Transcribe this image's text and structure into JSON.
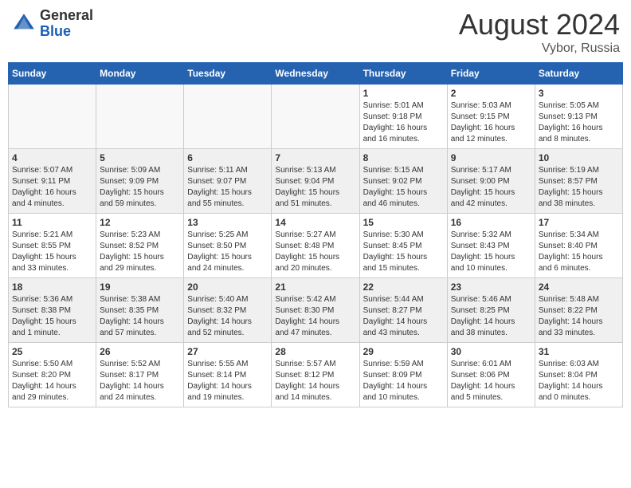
{
  "header": {
    "logo_general": "General",
    "logo_blue": "Blue",
    "month_year": "August 2024",
    "location": "Vybor, Russia"
  },
  "weekdays": [
    "Sunday",
    "Monday",
    "Tuesday",
    "Wednesday",
    "Thursday",
    "Friday",
    "Saturday"
  ],
  "weeks": [
    [
      {
        "day": "",
        "info": ""
      },
      {
        "day": "",
        "info": ""
      },
      {
        "day": "",
        "info": ""
      },
      {
        "day": "",
        "info": ""
      },
      {
        "day": "1",
        "info": "Sunrise: 5:01 AM\nSunset: 9:18 PM\nDaylight: 16 hours\nand 16 minutes."
      },
      {
        "day": "2",
        "info": "Sunrise: 5:03 AM\nSunset: 9:15 PM\nDaylight: 16 hours\nand 12 minutes."
      },
      {
        "day": "3",
        "info": "Sunrise: 5:05 AM\nSunset: 9:13 PM\nDaylight: 16 hours\nand 8 minutes."
      }
    ],
    [
      {
        "day": "4",
        "info": "Sunrise: 5:07 AM\nSunset: 9:11 PM\nDaylight: 16 hours\nand 4 minutes."
      },
      {
        "day": "5",
        "info": "Sunrise: 5:09 AM\nSunset: 9:09 PM\nDaylight: 15 hours\nand 59 minutes."
      },
      {
        "day": "6",
        "info": "Sunrise: 5:11 AM\nSunset: 9:07 PM\nDaylight: 15 hours\nand 55 minutes."
      },
      {
        "day": "7",
        "info": "Sunrise: 5:13 AM\nSunset: 9:04 PM\nDaylight: 15 hours\nand 51 minutes."
      },
      {
        "day": "8",
        "info": "Sunrise: 5:15 AM\nSunset: 9:02 PM\nDaylight: 15 hours\nand 46 minutes."
      },
      {
        "day": "9",
        "info": "Sunrise: 5:17 AM\nSunset: 9:00 PM\nDaylight: 15 hours\nand 42 minutes."
      },
      {
        "day": "10",
        "info": "Sunrise: 5:19 AM\nSunset: 8:57 PM\nDaylight: 15 hours\nand 38 minutes."
      }
    ],
    [
      {
        "day": "11",
        "info": "Sunrise: 5:21 AM\nSunset: 8:55 PM\nDaylight: 15 hours\nand 33 minutes."
      },
      {
        "day": "12",
        "info": "Sunrise: 5:23 AM\nSunset: 8:52 PM\nDaylight: 15 hours\nand 29 minutes."
      },
      {
        "day": "13",
        "info": "Sunrise: 5:25 AM\nSunset: 8:50 PM\nDaylight: 15 hours\nand 24 minutes."
      },
      {
        "day": "14",
        "info": "Sunrise: 5:27 AM\nSunset: 8:48 PM\nDaylight: 15 hours\nand 20 minutes."
      },
      {
        "day": "15",
        "info": "Sunrise: 5:30 AM\nSunset: 8:45 PM\nDaylight: 15 hours\nand 15 minutes."
      },
      {
        "day": "16",
        "info": "Sunrise: 5:32 AM\nSunset: 8:43 PM\nDaylight: 15 hours\nand 10 minutes."
      },
      {
        "day": "17",
        "info": "Sunrise: 5:34 AM\nSunset: 8:40 PM\nDaylight: 15 hours\nand 6 minutes."
      }
    ],
    [
      {
        "day": "18",
        "info": "Sunrise: 5:36 AM\nSunset: 8:38 PM\nDaylight: 15 hours\nand 1 minute."
      },
      {
        "day": "19",
        "info": "Sunrise: 5:38 AM\nSunset: 8:35 PM\nDaylight: 14 hours\nand 57 minutes."
      },
      {
        "day": "20",
        "info": "Sunrise: 5:40 AM\nSunset: 8:32 PM\nDaylight: 14 hours\nand 52 minutes."
      },
      {
        "day": "21",
        "info": "Sunrise: 5:42 AM\nSunset: 8:30 PM\nDaylight: 14 hours\nand 47 minutes."
      },
      {
        "day": "22",
        "info": "Sunrise: 5:44 AM\nSunset: 8:27 PM\nDaylight: 14 hours\nand 43 minutes."
      },
      {
        "day": "23",
        "info": "Sunrise: 5:46 AM\nSunset: 8:25 PM\nDaylight: 14 hours\nand 38 minutes."
      },
      {
        "day": "24",
        "info": "Sunrise: 5:48 AM\nSunset: 8:22 PM\nDaylight: 14 hours\nand 33 minutes."
      }
    ],
    [
      {
        "day": "25",
        "info": "Sunrise: 5:50 AM\nSunset: 8:20 PM\nDaylight: 14 hours\nand 29 minutes."
      },
      {
        "day": "26",
        "info": "Sunrise: 5:52 AM\nSunset: 8:17 PM\nDaylight: 14 hours\nand 24 minutes."
      },
      {
        "day": "27",
        "info": "Sunrise: 5:55 AM\nSunset: 8:14 PM\nDaylight: 14 hours\nand 19 minutes."
      },
      {
        "day": "28",
        "info": "Sunrise: 5:57 AM\nSunset: 8:12 PM\nDaylight: 14 hours\nand 14 minutes."
      },
      {
        "day": "29",
        "info": "Sunrise: 5:59 AM\nSunset: 8:09 PM\nDaylight: 14 hours\nand 10 minutes."
      },
      {
        "day": "30",
        "info": "Sunrise: 6:01 AM\nSunset: 8:06 PM\nDaylight: 14 hours\nand 5 minutes."
      },
      {
        "day": "31",
        "info": "Sunrise: 6:03 AM\nSunset: 8:04 PM\nDaylight: 14 hours\nand 0 minutes."
      }
    ]
  ]
}
